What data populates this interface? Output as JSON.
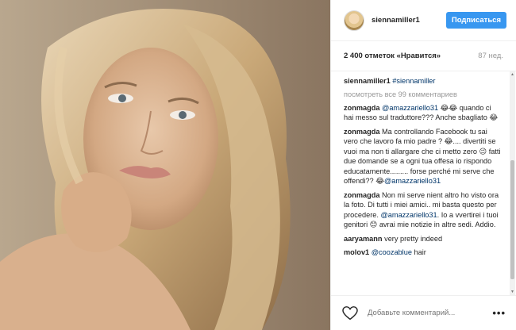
{
  "post": {
    "username": "siennamiller1",
    "follow_label": "Подписаться",
    "likes": "2 400 отметок «Нравится»",
    "age": "87 нед."
  },
  "caption": {
    "user": "siennamiller1",
    "text": "#siennamiller"
  },
  "load_more": "посмотреть все 99 комментариев",
  "comments": [
    {
      "user": "zonmagda",
      "mention": "@amazzariello31",
      "text": " 😂😂 quando ci hai messo sul traduttore??? Anche sbagliato 😂"
    },
    {
      "user": "zonmagda",
      "mention": "",
      "text": "Ma controllando Facebook tu sai vero che lavoro fa mio padre ? 😂.... divertiti se vuoi ma non ti allargare che ci metto zero 😉 fatti due domande se a ogni tua offesa io rispondo educatamente......... forse perché mi serve che offendi?? 😂",
      "mention_end": "@amazzariello31"
    },
    {
      "user": "zonmagda",
      "mention": "",
      "text": "Non mi serve nient altro ho visto ora la foto. Di tutti i miei amici.. mi basta questo per procedere. ",
      "mention_mid": "@amazzariello31",
      "text_after": ". Io a vvertirei i tuoi genitori 😊 avrai mie notizie in altre sedi. Addio."
    },
    {
      "user": "aaryamann",
      "mention": "",
      "text": "very pretty indeed"
    },
    {
      "user": "molov1",
      "mention": "@coozablue",
      "text": " hair"
    }
  ],
  "footer": {
    "comment_placeholder": "Добавьте комментарий...",
    "more_label": "•••"
  },
  "icons": {
    "heart": "heart-icon",
    "more": "more-options-icon"
  }
}
